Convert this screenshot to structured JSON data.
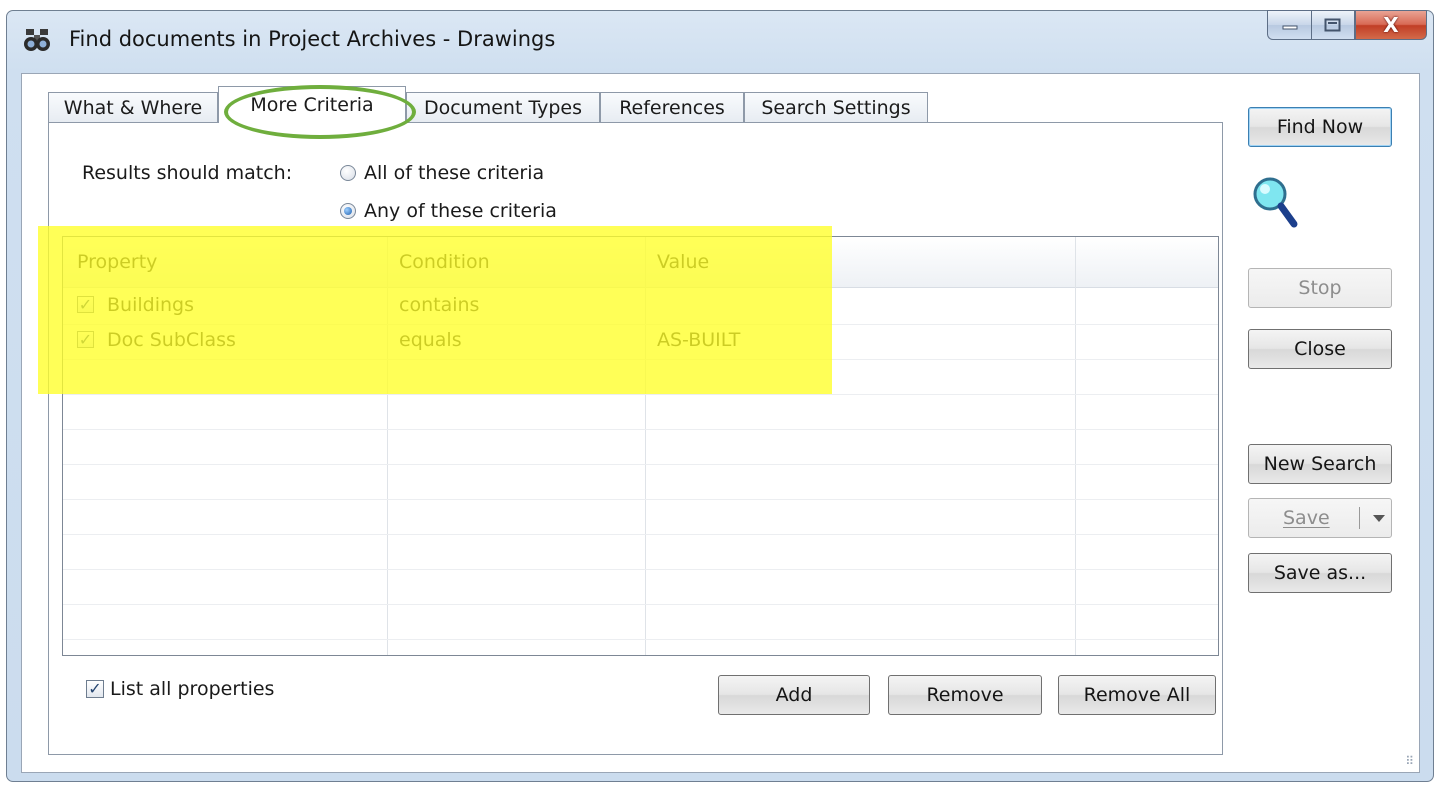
{
  "window": {
    "title": "Find documents in Project Archives - Drawings",
    "close_glyph": "X"
  },
  "tabs": [
    {
      "label": "What & Where"
    },
    {
      "label": "More Criteria"
    },
    {
      "label": "Document Types"
    },
    {
      "label": "References"
    },
    {
      "label": "Search Settings"
    }
  ],
  "match": {
    "label": "Results should match:",
    "option_all": "All of these criteria",
    "option_any": "Any of these criteria",
    "selected": "any"
  },
  "grid": {
    "columns": [
      "Property",
      "Condition",
      "Value"
    ],
    "rows": [
      {
        "checked": true,
        "property": "Buildings",
        "condition": "contains",
        "value": ""
      },
      {
        "checked": true,
        "property": "Doc SubClass",
        "condition": "equals",
        "value": "AS-BUILT"
      }
    ]
  },
  "list_all": {
    "label": "List all properties",
    "checked": true
  },
  "buttons": {
    "add": "Add",
    "remove": "Remove",
    "remove_all": "Remove All",
    "find_now": "Find Now",
    "stop": "Stop",
    "close": "Close",
    "new_search": "New Search",
    "save": "Save",
    "save_as": "Save as..."
  },
  "annotations": {
    "highlight_color": "#ffff28",
    "circle_color": "#6fae3d"
  }
}
